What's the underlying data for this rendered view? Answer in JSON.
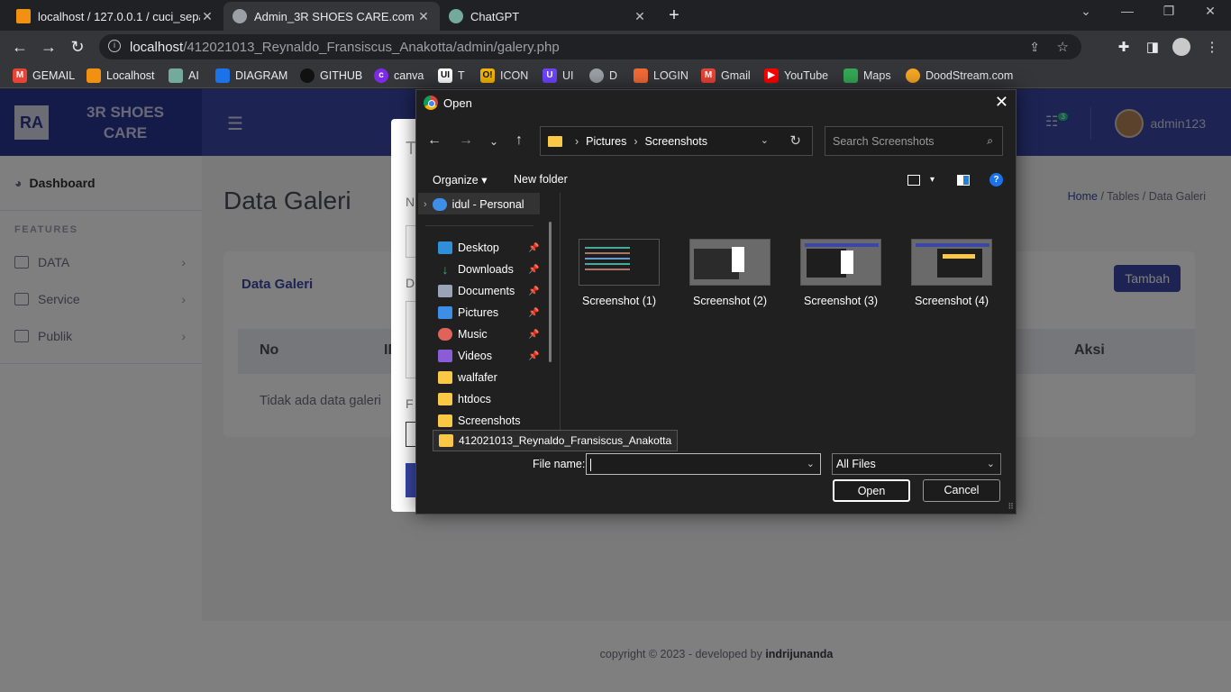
{
  "browser": {
    "tabs": [
      {
        "title": "localhost / 127.0.0.1 / cuci_sepatu",
        "close": "✕"
      },
      {
        "title": "Admin_3R SHOES CARE.com",
        "close": "✕"
      },
      {
        "title": "ChatGPT",
        "close": "✕"
      }
    ],
    "url_host": "localhost",
    "url_path": "/412021013_Reynaldo_Fransiscus_Anakotta/admin/galery.php",
    "bookmarks": [
      "GEMAIL",
      "Localhost",
      "AI",
      "DIAGRAM",
      "GITHUB",
      "canva",
      "T",
      "ICON",
      "UI",
      "D",
      "LOGIN",
      "Gmail",
      "YouTube",
      "Maps",
      "DoodStream.com"
    ]
  },
  "app": {
    "logo": "RA",
    "brand_line1": "3R SHOES",
    "brand_line2": "CARE",
    "notif_count": "3",
    "username": "admin123"
  },
  "sidebar": {
    "dashboard": "Dashboard",
    "section": "FEATURES",
    "items": [
      "DATA",
      "Service",
      "Publik"
    ]
  },
  "content": {
    "page_title": "Data Galeri",
    "breadcrumb": {
      "home": "Home",
      "tables": "Tables",
      "current": "Data Galeri",
      "sep": "/"
    },
    "card_title": "Data Galeri",
    "add_button": "Tambah",
    "columns": {
      "no": "No",
      "id": "ID",
      "aksi": "Aksi"
    },
    "empty_text": "Tidak ada data galeri"
  },
  "footer": {
    "text": "copyright © 2023 - developed by ",
    "author": "indrijunanda"
  },
  "dialog": {
    "title": "Open",
    "path": [
      "Pictures",
      "Screenshots"
    ],
    "search_placeholder": "Search Screenshots",
    "organize": "Organize",
    "new_folder": "New folder",
    "tree": [
      {
        "label": "idul - Personal",
        "color": "#3c8ee6"
      },
      {
        "label": "Desktop",
        "color": "#2f8fd8"
      },
      {
        "label": "Downloads",
        "color": "#36b37e"
      },
      {
        "label": "Documents",
        "color": "#9aa4b8"
      },
      {
        "label": "Pictures",
        "color": "#3c8ee6"
      },
      {
        "label": "Music",
        "color": "#e0635a"
      },
      {
        "label": "Videos",
        "color": "#8a5cd6"
      },
      {
        "label": "walfafer",
        "color": "#f8c846"
      },
      {
        "label": "htdocs",
        "color": "#f8c846"
      },
      {
        "label": "Screenshots",
        "color": "#f8c846"
      }
    ],
    "tooltip": "412021013_Reynaldo_Fransiscus_Anakotta",
    "files": [
      "Screenshot (1)",
      "Screenshot (2)",
      "Screenshot (3)",
      "Screenshot (4)"
    ],
    "file_name_label": "File name:",
    "file_name_value": "",
    "file_type": "All Files",
    "open_button": "Open",
    "cancel_button": "Cancel"
  }
}
